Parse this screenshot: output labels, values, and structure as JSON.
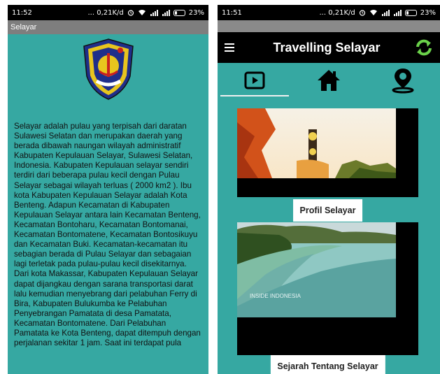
{
  "left": {
    "status": {
      "time": "11:52",
      "speed": "... 0,21K/d",
      "battery": "23%"
    },
    "title": "Selayar",
    "body": "Selayar adalah pulau yang terpisah dari daratan Sulawesi Selatan dan merupakan daerah yang berada dibawah naungan wilayah administratif Kabupaten Kepulauan Selayar, Sulawesi Selatan, Indonesia. Kabupaten Kepulauan selayar sendiri terdiri dari beberapa pulau kecil dengan Pulau Selayar sebagai wilayah terluas ( 2000 km2 ). Ibu kota Kabupaten Kepulauan  Selayar adalah Kota Benteng.  Adapun Kecamatan di Kabupaten Kepulauan Selayar antara lain Kecamatan Benteng, Kecamatan Bontoharu, Kecamatan Bontomanai, Kecamatan Bontomatene, Kecamatan  Bontosikuyu dan Kecamatan Buki. Kecamatan-kecamatan itu sebagian berada di Pulau Selayar dan sebagaian lagi terletak pada pulau-pulau kecil disekitarnya. Dari kota Makassar, Kabupaten Kepulauan Selayar dapat dijangkau dengan sarana transportasi  darat lalu kemudian menyebrang dari pelabuhan Ferry di Bira, Kabupaten Bulukumba ke Pelabuhan Penyebrangan Pamatata di desa Pamatata, Kecamatan Bontomatene. Dari  Pelabuhan Pamatata ke Kota Benteng, dapat ditempuh dengan perjalanan sekitar 1 jam.  Saat ini terdapat pula"
  },
  "right": {
    "status": {
      "time": "11:51",
      "speed": "... 0,21K/d",
      "battery": "23%"
    },
    "toolbar": {
      "title": "Travelling Selayar"
    },
    "cards": [
      {
        "label": "Profil Selayar"
      },
      {
        "label": "Sejarah Tentang Selayar",
        "watermark": "INSIDE INDONESIA"
      }
    ]
  },
  "colors": {
    "background": "#36a8a2",
    "refresh": "#6ad14a"
  }
}
